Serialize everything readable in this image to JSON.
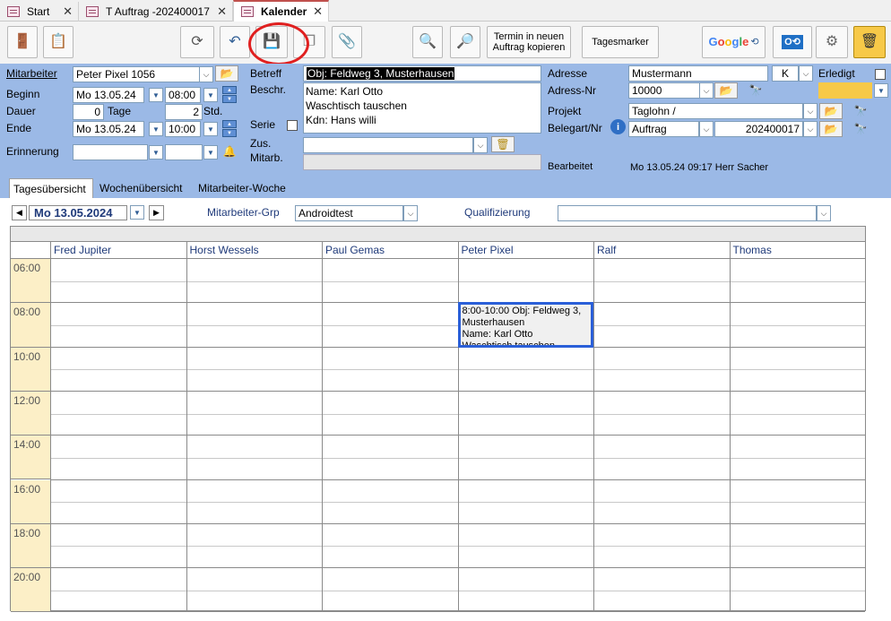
{
  "tabs": [
    {
      "label": "Start"
    },
    {
      "label": "T Auftrag -202400017"
    },
    {
      "label": "Kalender"
    }
  ],
  "toolbar": {
    "copy_button": "Termin in neuen Auftrag kopieren",
    "tagesmarker": "Tagesmarker",
    "google": "Google"
  },
  "form": {
    "mitarbeiter_label": "Mitarbeiter",
    "mitarbeiter_value": "Peter Pixel 1056",
    "beginn_label": "Beginn",
    "beginn_date": "Mo 13.05.24",
    "beginn_time": "08:00",
    "dauer_label": "Dauer",
    "dauer_days": "0",
    "tage_label": "Tage",
    "dauer_hours": "2",
    "std_label": "Std.",
    "ende_label": "Ende",
    "ende_date": "Mo 13.05.24",
    "ende_time": "10:00",
    "erinnerung_label": "Erinnerung",
    "betreff_label": "Betreff",
    "betreff_value": "Obj: Feldweg 3, Musterhausen",
    "beschr_label": "Beschr.",
    "beschr_lines": [
      "Name: Karl Otto",
      "Waschtisch tauschen",
      "Kdn: Hans willi"
    ],
    "serie_label": "Serie",
    "zus_label": "Zus.",
    "mitarb_label": "Mitarb.",
    "adresse_label": "Adresse",
    "adresse_value": "Mustermann",
    "adresse_k": "K",
    "erledigt_label": "Erledigt",
    "adressnr_label": "Adress-Nr",
    "adressnr_value": "10000",
    "projekt_label": "Projekt",
    "projekt_value": "Taglohn /",
    "belegart_label": "Belegart/Nr",
    "belegart_value": "Auftrag",
    "belegnr_value": "202400017",
    "bearbeitet_label": "Bearbeitet",
    "bearbeitet_value": "Mo 13.05.24 09:17 Herr Sacher"
  },
  "subtabs": [
    "Tagesübersicht",
    "Wochenübersicht",
    "Mitarbeiter-Woche"
  ],
  "nav": {
    "date": "Mo 13.05.2024",
    "grp_label": "Mitarbeiter-Grp",
    "grp_value": "Androidtest",
    "qual_label": "Qualifizierung",
    "qual_value": ""
  },
  "calendar": {
    "columns": [
      "Fred Jupiter",
      "Horst Wessels",
      "Paul Gemas",
      "Peter Pixel",
      "Ralf",
      "Thomas"
    ],
    "times": [
      "06:00",
      "08:00",
      "10:00",
      "12:00",
      "14:00",
      "16:00",
      "18:00",
      "20:00"
    ],
    "appointment": {
      "lines": [
        "8:00-10:00 Obj: Feldweg 3,",
        "Musterhausen",
        "Name: Karl Otto",
        "Waschtisch tauschen"
      ]
    }
  },
  "colors": {
    "form_bg": "#9bb9e6",
    "accent_red": "#e02020",
    "highlight": "#f7c948",
    "appointment_border": "#2a5fd8"
  }
}
